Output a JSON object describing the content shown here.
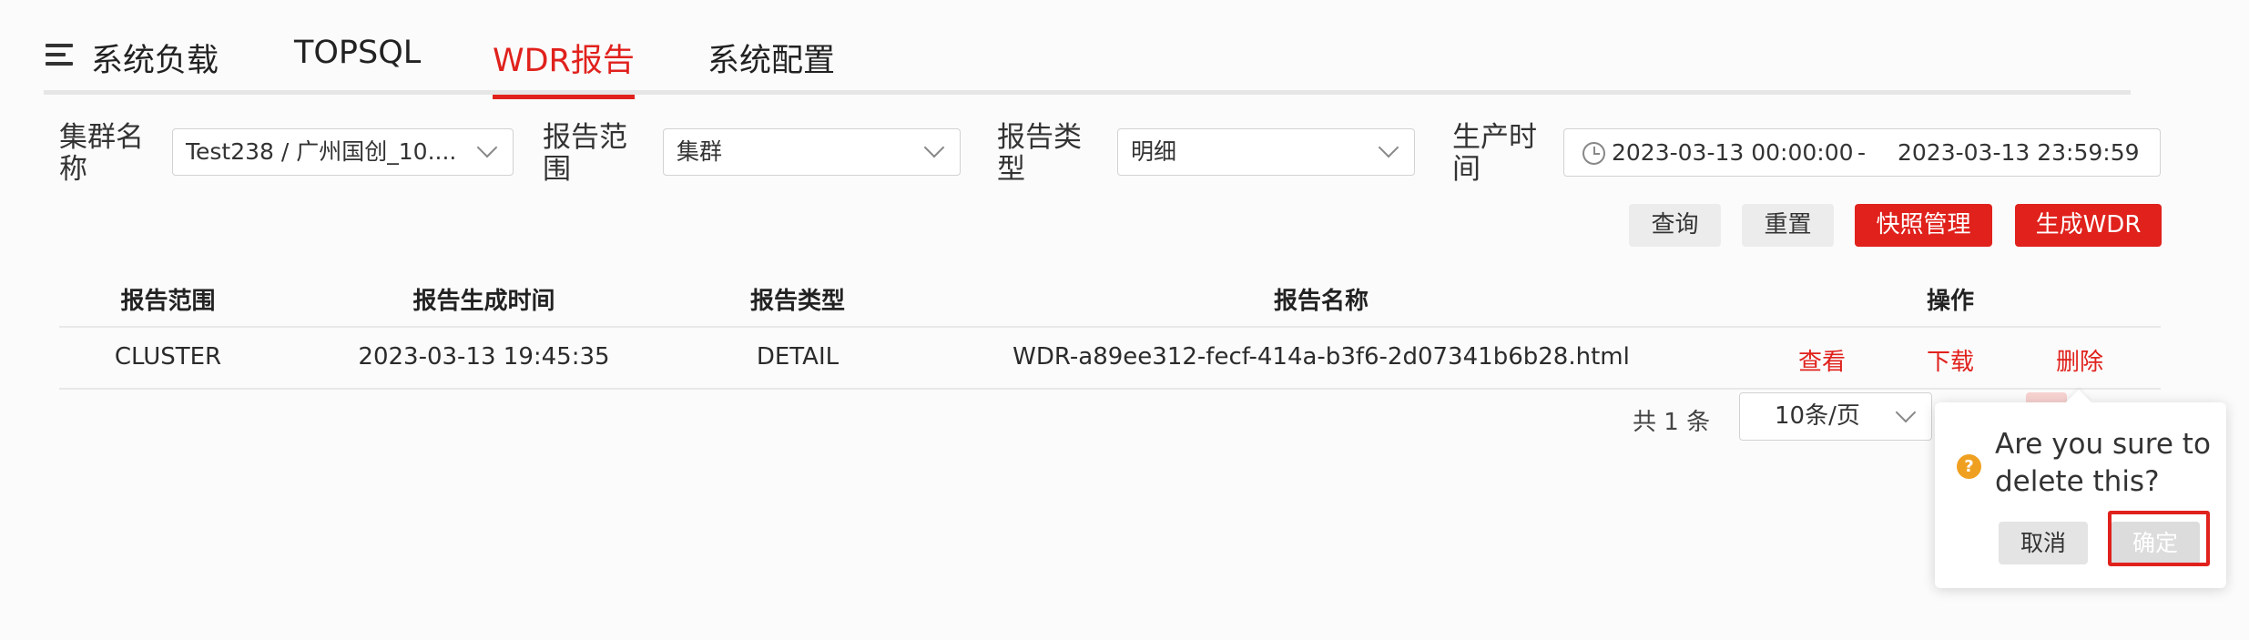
{
  "tabs": {
    "items": [
      {
        "label": "系统负载",
        "active": false
      },
      {
        "label": "TOPSQL",
        "active": false
      },
      {
        "label": "WDR报告",
        "active": true
      },
      {
        "label": "系统配置",
        "active": false
      }
    ]
  },
  "filters": {
    "cluster": {
      "label": "集群名称",
      "value": "Test238 / 广州国创_10...."
    },
    "scope": {
      "label": "报告范围",
      "value": "集群"
    },
    "type": {
      "label": "报告类型",
      "value": "明细"
    },
    "time": {
      "label": "生产时间",
      "start": "2023-03-13 00:00:00",
      "separator": "-",
      "end": "2023-03-13 23:59:59"
    }
  },
  "actions": {
    "query": "查询",
    "reset": "重置",
    "snapshot": "快照管理",
    "generate": "生成WDR"
  },
  "table": {
    "headers": [
      "报告范围",
      "报告生成时间",
      "报告类型",
      "报告名称",
      "操作"
    ],
    "rows": [
      {
        "scope": "CLUSTER",
        "time": "2023-03-13 19:45:35",
        "type": "DETAIL",
        "name": "WDR-a89ee312-fecf-414a-b3f6-2d07341b6b28.html",
        "ops": [
          "查看",
          "下载",
          "删除"
        ]
      }
    ]
  },
  "pagination": {
    "total": "共 1 条",
    "page_size": "10条/页"
  },
  "popconfirm": {
    "icon": "?",
    "message": "Are you sure to delete this?",
    "cancel": "取消",
    "confirm": "确定"
  },
  "colors": {
    "accent": "#e0211c",
    "warning": "#f0a020"
  }
}
